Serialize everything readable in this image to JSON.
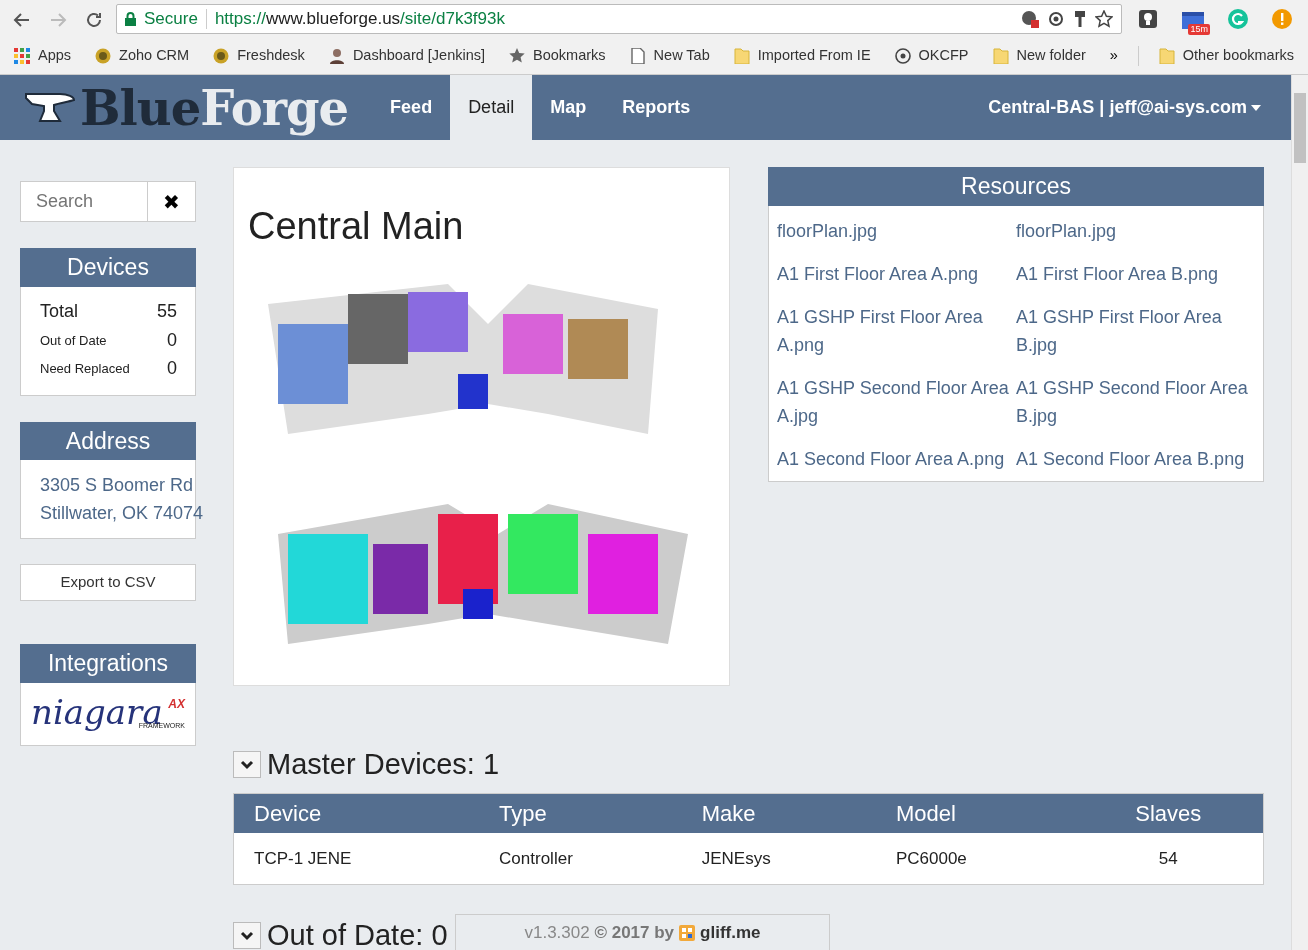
{
  "browser": {
    "secure_label": "Secure",
    "url_scheme": "https://",
    "url_host": "www.blueforge.us",
    "url_path": "/site/d7k3f93k",
    "forward_disabled": true,
    "extension_badge": "15m"
  },
  "bookmarks": [
    {
      "label": "Apps",
      "kind": "apps"
    },
    {
      "label": "Zoho CRM",
      "kind": "favicon"
    },
    {
      "label": "Freshdesk",
      "kind": "favicon"
    },
    {
      "label": "Dashboard [Jenkins]",
      "kind": "avatar"
    },
    {
      "label": "Bookmarks",
      "kind": "star"
    },
    {
      "label": "New Tab",
      "kind": "page"
    },
    {
      "label": "Imported From IE",
      "kind": "folder"
    },
    {
      "label": "OKCFP",
      "kind": "ring"
    },
    {
      "label": "New folder",
      "kind": "folder"
    },
    {
      "label": "»",
      "kind": "more"
    },
    {
      "label": "Other bookmarks",
      "kind": "folder"
    }
  ],
  "brand": {
    "dark": "Blue",
    "light": "Forge"
  },
  "nav": [
    {
      "label": "Feed",
      "selected": false
    },
    {
      "label": "Detail",
      "selected": true
    },
    {
      "label": "Map",
      "selected": false
    },
    {
      "label": "Reports",
      "selected": false
    }
  ],
  "account": "Central-BAS | jeff@ai-sys.com",
  "search": {
    "placeholder": "Search",
    "clear": "✖"
  },
  "devices": {
    "title": "Devices",
    "rows": [
      {
        "label": "Total",
        "value": "55",
        "kind": "main"
      },
      {
        "label": "Out of Date",
        "value": "0",
        "kind": "minor"
      },
      {
        "label": "Need Replaced",
        "value": "0",
        "kind": "minor"
      }
    ]
  },
  "address": {
    "title": "Address",
    "lines": [
      "3305 S Boomer Rd",
      "Stillwater, OK 74074"
    ]
  },
  "export_button": "Export to CSV",
  "integrations": {
    "title": "Integrations",
    "logo": {
      "word": "niagara",
      "sup": "AX",
      "sub": "FRAMEWORK"
    }
  },
  "site": {
    "title": "Central Main"
  },
  "resources": {
    "title": "Resources",
    "items": [
      "floorPlan.jpg",
      "floorPlan.jpg",
      "A1 First Floor Area A.png",
      "A1 First Floor Area B.png",
      "A1 GSHP First Floor Area A.png",
      "A1 GSHP First Floor Area B.jpg",
      "A1 GSHP Second Floor Area A.jpg",
      "A1 GSHP Second Floor Area B.jpg",
      "A1 Second Floor Area A.png",
      "A1 Second Floor Area B.png"
    ]
  },
  "sections": [
    {
      "title": "Master Devices: 1",
      "expanded": true,
      "table": {
        "columns": [
          "Device",
          "Type",
          "Make",
          "Model",
          "Slaves"
        ],
        "rows": [
          [
            "TCP-1 JENE",
            "Controller",
            "JENEsys",
            "PC6000e",
            "54"
          ]
        ]
      }
    },
    {
      "title": "Out of Date: 0",
      "expanded": true
    }
  ],
  "footer": {
    "version": "v1.3.302 **© 2017 by**",
    "brand": "gliff.me"
  }
}
